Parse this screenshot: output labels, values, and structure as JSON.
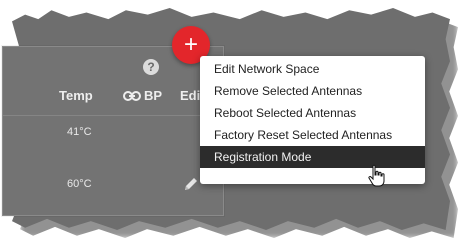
{
  "panel": {
    "help_icon": "question-circle-icon",
    "columns": {
      "temp": "Temp",
      "bp": "BP",
      "bp_icon": "link-icon",
      "edit": "Edi"
    },
    "rows": [
      {
        "temp": "41°C"
      },
      {
        "temp": "60°C",
        "edit_icon": "pencil-icon"
      }
    ]
  },
  "add_button": {
    "label": "+",
    "color": "#e3262b"
  },
  "menu": {
    "items": [
      {
        "label": "Edit Network Space"
      },
      {
        "label": "Remove Selected Antennas"
      },
      {
        "label": "Reboot Selected Antennas"
      },
      {
        "label": "Factory Reset Selected Antennas"
      },
      {
        "label": "Registration Mode",
        "highlighted": true
      }
    ]
  },
  "cursor": "hand-pointer-icon"
}
